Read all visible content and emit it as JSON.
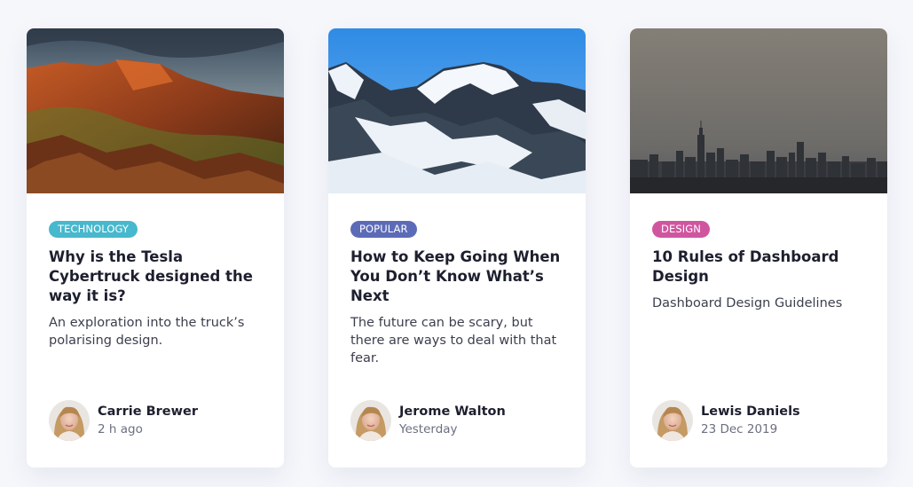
{
  "cards": [
    {
      "tag": "TECHNOLOGY",
      "tag_color": "#47b8cd",
      "title": "Why is the Tesla Cybertruck designed the way it is?",
      "description": "An exploration into the truck’s polarising design.",
      "author": "Carrie Brewer",
      "time": "2 h ago"
    },
    {
      "tag": "POPULAR",
      "tag_color": "#5c6bb8",
      "title": "How to Keep Going When You Don’t Know What’s Next",
      "description": "The future can be scary, but there are ways to deal with that fear.",
      "author": "Jerome Walton",
      "time": "Yesterday"
    },
    {
      "tag": "DESIGN",
      "tag_color": "#d0559f",
      "title": "10 Rules of Dashboard Design",
      "description": "Dashboard Design Guidelines",
      "author": "Lewis Daniels",
      "time": "23 Dec 2019"
    }
  ]
}
